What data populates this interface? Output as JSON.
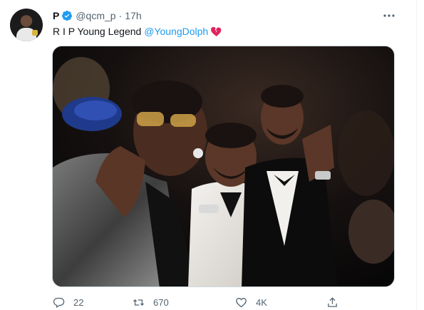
{
  "tweet": {
    "display_name": "P",
    "handle": "@qcm_p",
    "separator": "·",
    "time": "17h",
    "text_prefix": "R I P Young Legend ",
    "mention": "@YoungDolph",
    "emoji": "broken-heart-icon"
  },
  "actions": {
    "replies": "22",
    "retweets": "670",
    "likes": "4K"
  },
  "colors": {
    "accent": "#1d9bf0",
    "secondary_text": "#536471",
    "broken_heart": "#e0245e"
  }
}
